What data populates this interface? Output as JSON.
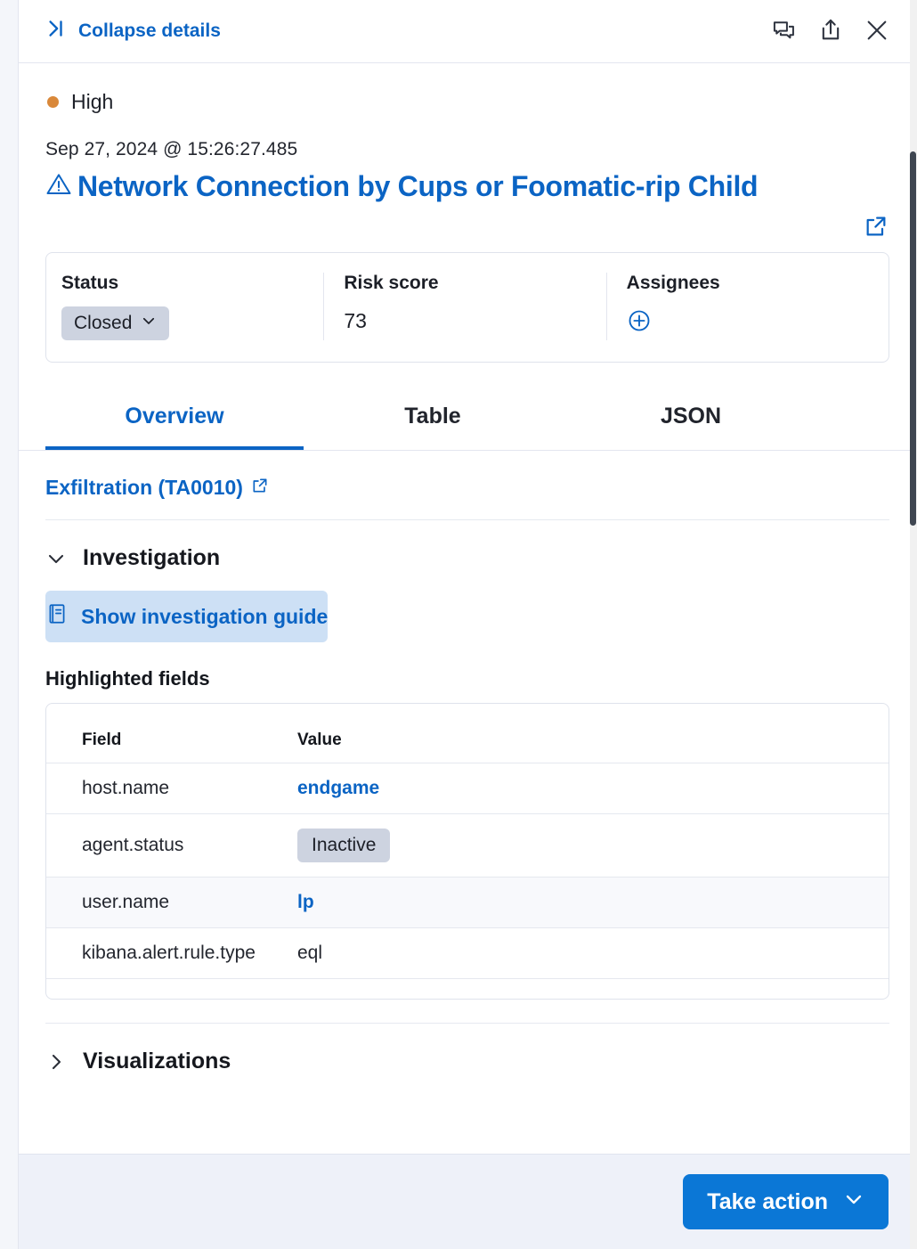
{
  "header": {
    "collapse_label": "Collapse details",
    "icons": {
      "collapse": "collapse-right-icon",
      "comments": "comments-icon",
      "share": "share-icon",
      "close": "close-icon"
    }
  },
  "alert": {
    "severity": "High",
    "severity_color": "#d9883a",
    "timestamp": "Sep 27, 2024 @ 15:26:27.485",
    "title": "Network Connection by Cups or Foomatic-rip Child",
    "title_color": "#0b64c4"
  },
  "status_panel": {
    "status_label": "Status",
    "status_value": "Closed",
    "risk_label": "Risk score",
    "risk_value": "73",
    "assignees_label": "Assignees"
  },
  "tabs": [
    {
      "label": "Overview",
      "active": true
    },
    {
      "label": "Table",
      "active": false
    },
    {
      "label": "JSON",
      "active": false
    }
  ],
  "overview": {
    "mitre_link": "Exfiltration (TA0010)",
    "investigation_section": "Investigation",
    "guide_button": "Show investigation guide",
    "highlighted_fields_title": "Highlighted fields",
    "table": {
      "columns": [
        "Field",
        "Value"
      ],
      "rows": [
        {
          "field": "host.name",
          "value": "endgame",
          "kind": "link"
        },
        {
          "field": "agent.status",
          "value": "Inactive",
          "kind": "badge"
        },
        {
          "field": "user.name",
          "value": "lp",
          "kind": "link"
        },
        {
          "field": "kibana.alert.rule.type",
          "value": "eql",
          "kind": "plain"
        }
      ]
    },
    "visualizations_section": "Visualizations"
  },
  "footer": {
    "take_action_label": "Take action"
  }
}
